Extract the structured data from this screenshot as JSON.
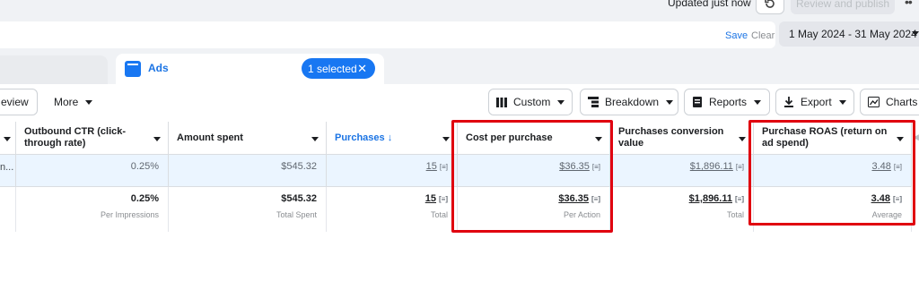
{
  "header": {
    "updated_text": "Updated just now",
    "publish_label": "Review and publish",
    "more_glyph": "••"
  },
  "search": {
    "save_label": "Save",
    "clear_label": "Clear",
    "date_range": "1 May 2024 - 31 May 2024"
  },
  "tabs": {
    "ads_label": "Ads",
    "selected_label": "1 selected",
    "close_glyph": "✕"
  },
  "toolbar": {
    "preview_label": "eview",
    "more_label": "More",
    "custom_label": "Custom",
    "breakdown_label": "Breakdown",
    "reports_label": "Reports",
    "export_label": "Export",
    "charts_label": "Charts"
  },
  "table": {
    "headers": [
      "Outbound CTR (click-through rate)",
      "Amount spent",
      "Purchases ↓",
      "Cost per purchase",
      "Purchases conversion value",
      "Purchase ROAS (return on ad spend)"
    ],
    "row1": {
      "name_truncated": "n...",
      "ctr": "0.25%",
      "amount": "$545.32",
      "purchases": "15",
      "cost": "$36.35",
      "conv_value": "$1,896.11",
      "roas": "3.48"
    },
    "totals": {
      "ctr": "0.25%",
      "ctr_sub": "Per Impressions",
      "amount": "$545.32",
      "amount_sub": "Total Spent",
      "purchases": "15",
      "purchases_sub": "Total",
      "cost": "$36.35",
      "cost_sub": "Per Action",
      "conv_value": "$1,896.11",
      "conv_value_sub": "Total",
      "roas": "3.48",
      "roas_sub": "Average"
    },
    "info_glyph": "[≡]"
  },
  "colors": {
    "accent": "#1877f2",
    "highlight_box": "#e0000f",
    "selected_row": "#ebf5ff"
  },
  "icons": [
    "undo-icon",
    "columns-icon",
    "breakdown-icon",
    "reports-icon",
    "export-icon",
    "charts-icon",
    "ads-icon",
    "close-icon",
    "sort-arrow-icon",
    "info-icon",
    "chevron-down-icon"
  ]
}
